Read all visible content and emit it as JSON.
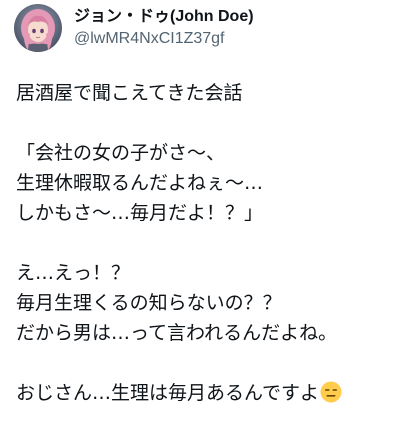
{
  "author": {
    "display_name": "ジョン・ドゥ(John Doe)",
    "handle": "@lwMR4NxCI1Z37gf",
    "avatar_icon": "avatar-anime-pink-hair"
  },
  "tweet": {
    "lines": [
      "居酒屋で聞こえてきた会話",
      "",
      "「会社の女の子がさ〜、",
      "生理休暇取るんだよねぇ〜…",
      "しかもさ〜…毎月だよ！？」",
      "",
      "え…えっ！？",
      "毎月生理くるの知らないの？？",
      "だから男は…って言われるんだよね。",
      "",
      "おじさん…生理は毎月あるんですよ"
    ],
    "trailing_emoji": "expressionless-face-emoji"
  },
  "colors": {
    "text": "#0f1419",
    "secondary": "#536471",
    "emoji_face": "#ffcc4d"
  }
}
